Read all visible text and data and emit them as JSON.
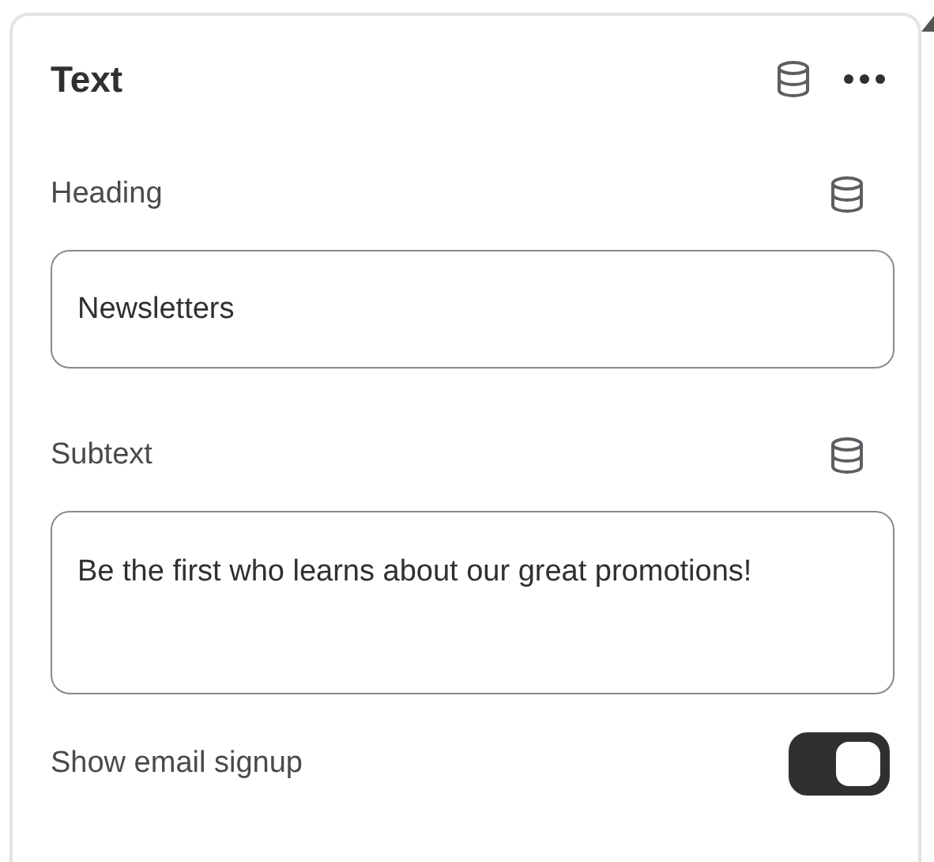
{
  "panel": {
    "title": "Text"
  },
  "fields": [
    {
      "kind": "input",
      "label": "Heading",
      "value": "Newsletters"
    },
    {
      "kind": "textarea",
      "label": "Subtext",
      "value": "Be the first who learns about our great promotions!"
    }
  ],
  "toggle": {
    "label": "Show email signup",
    "on": true
  }
}
